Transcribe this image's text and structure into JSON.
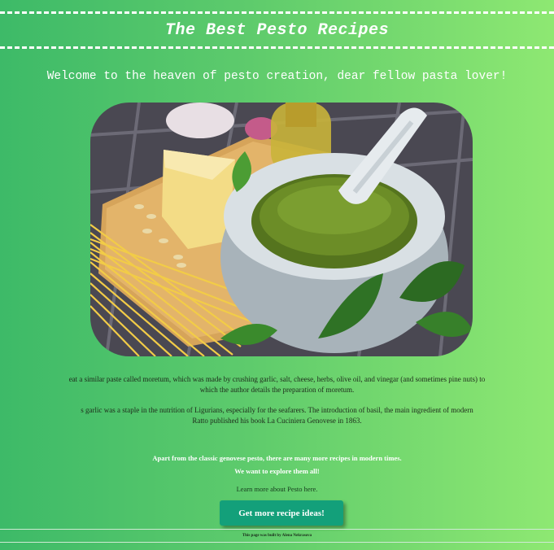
{
  "header": {
    "title": "The Best Pesto Recipes"
  },
  "welcome": "Welcome to the heaven of pesto creation, dear fellow pasta lover!",
  "history": {
    "paragraph1_line1": "eat a similar paste called moretum, which was made by crushing garlic, salt, cheese, herbs, olive oil, and vinegar (and sometimes pine nuts) to",
    "paragraph1_line2": "which the author details the preparation of moretum.",
    "paragraph2_line1": "s garlic was a staple in the nutrition of Ligurians, especially for the seafarers. The introduction of basil, the main ingredient of modern",
    "paragraph2_line2": "Ratto published his book La Cuciniera Genovese in 1863."
  },
  "intro": {
    "line1": "Apart from the classic genovese pesto, there are many more recipes in modern times.",
    "line2": "We want to explore them all!"
  },
  "learn_more": "Learn more about Pesto here.",
  "cta_label": "Get more recipe ideas!",
  "footer": "This page was built by Alena Nekrasova",
  "colors": {
    "background_start": "#3dba68",
    "background_end": "#8ee872",
    "button": "#13a07a"
  }
}
